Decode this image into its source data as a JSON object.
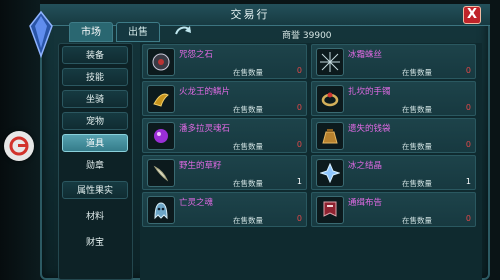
{
  "window": {
    "title": "交易行",
    "close_label": "X"
  },
  "tabs": [
    {
      "label": "市场",
      "active": true
    },
    {
      "label": "出售",
      "active": false
    }
  ],
  "currency": {
    "label": "商誉",
    "value": "39900"
  },
  "sidebar": {
    "items": [
      {
        "label": "装备"
      },
      {
        "label": "技能"
      },
      {
        "label": "坐骑"
      },
      {
        "label": "宠物"
      },
      {
        "label": "道具",
        "selected": true
      },
      {
        "label": "勋章"
      },
      {
        "label": "属性果实"
      },
      {
        "label": "材料"
      },
      {
        "label": "财宝"
      }
    ]
  },
  "items": [
    {
      "name": "咒怨之石",
      "qty_label": "在售数量",
      "qty": "0",
      "icon": "cursed-stone-icon"
    },
    {
      "name": "冰霜蛛丝",
      "qty_label": "在售数量",
      "qty": "0",
      "icon": "frost-spider-silk-icon"
    },
    {
      "name": "火龙王的鳞片",
      "qty_label": "在售数量",
      "qty": "0",
      "icon": "dragon-scale-icon"
    },
    {
      "name": "扎坎的手镯",
      "qty_label": "在售数量",
      "qty": "0",
      "icon": "bracelet-icon"
    },
    {
      "name": "潘多拉灵魂石",
      "qty_label": "在售数量",
      "qty": "0",
      "icon": "soul-stone-icon"
    },
    {
      "name": "遗失的钱袋",
      "qty_label": "在售数量",
      "qty": "0",
      "icon": "money-bag-icon"
    },
    {
      "name": "野生的草籽",
      "qty_label": "在售数量",
      "qty": "1",
      "icon": "grass-seed-icon"
    },
    {
      "name": "冰之结晶",
      "qty_label": "在售数量",
      "qty": "1",
      "icon": "ice-crystal-icon"
    },
    {
      "name": "亡灵之魂",
      "qty_label": "在售数量",
      "qty": "0",
      "icon": "undead-soul-icon"
    },
    {
      "name": "通缉布告",
      "qty_label": "在售数量",
      "qty": "0",
      "icon": "wanted-banner-icon"
    }
  ],
  "colors": {
    "item_name": "#e06ae4",
    "qty_zero": "#e24848",
    "accent": "#357c8a"
  }
}
